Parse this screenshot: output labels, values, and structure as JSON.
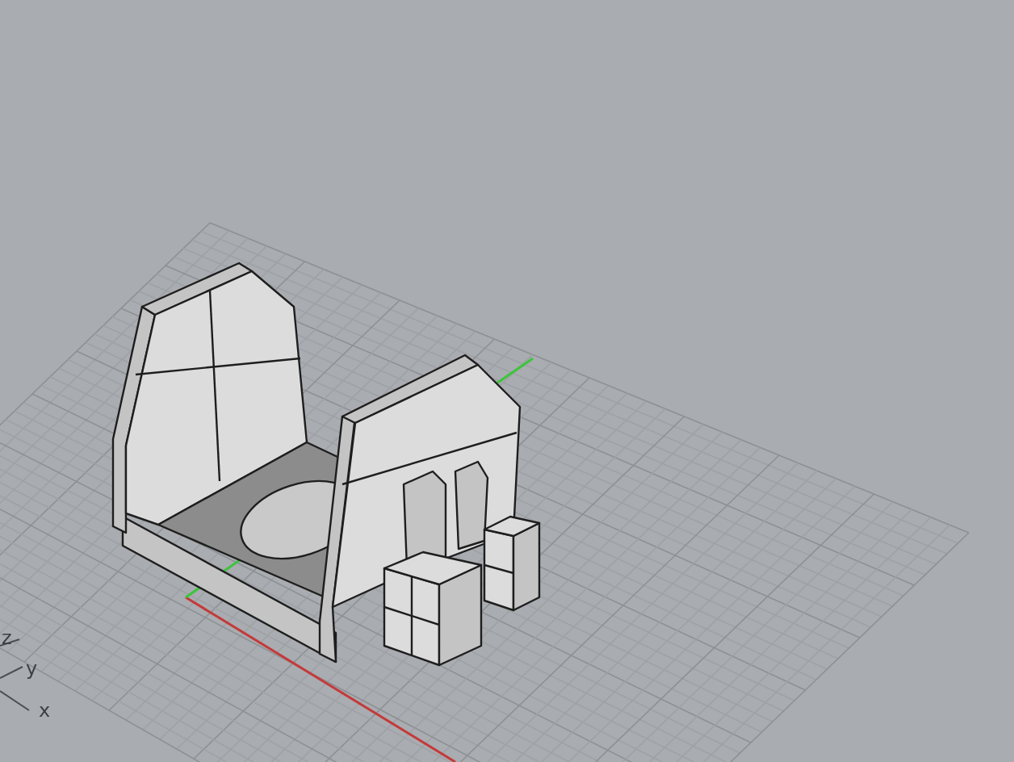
{
  "viewport": {
    "axis_labels": [
      {
        "label": "z"
      },
      {
        "label": "y"
      },
      {
        "label": "x"
      }
    ]
  }
}
